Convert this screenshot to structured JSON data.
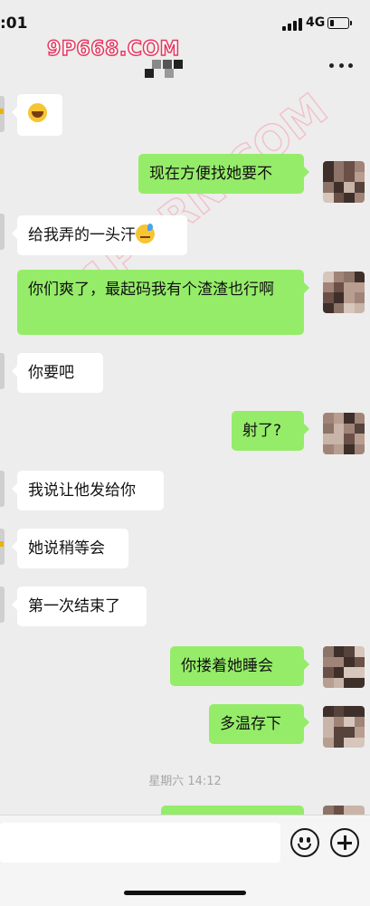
{
  "status_bar": {
    "time": ":01",
    "network": "4G",
    "battery_level": 0.22
  },
  "header": {
    "brand": "9P668.COM"
  },
  "watermark": {
    "text": "91PORN.COM"
  },
  "messages": [
    {
      "side": "in",
      "emoji": "laugh"
    },
    {
      "side": "out",
      "text": "现在方便找她要不"
    },
    {
      "side": "in",
      "text": "给我弄的一头汗",
      "emoji": "sweat"
    },
    {
      "side": "out",
      "text": "你们爽了，最起码我有个渣渣也行啊"
    },
    {
      "side": "in",
      "text": "你要吧"
    },
    {
      "side": "out",
      "text": "射了?"
    },
    {
      "side": "in",
      "text": "我说让他发给你"
    },
    {
      "side": "in",
      "text": "她说稍等会"
    },
    {
      "side": "in",
      "text": "第一次结束了"
    },
    {
      "side": "out",
      "text": "你搂着她睡会"
    },
    {
      "side": "out",
      "text": "多温存下"
    }
  ],
  "timestamp": "星期六 14:12",
  "input": {
    "value": ""
  }
}
